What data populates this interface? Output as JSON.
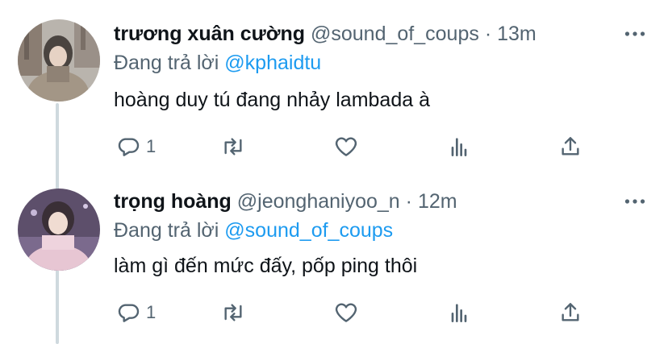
{
  "colors": {
    "text": "#0f1419",
    "muted": "#536471",
    "link": "#1d9bf0",
    "thread_line": "#cfd9de"
  },
  "tweets": [
    {
      "name": "trương xuân cường",
      "handle": "@sound_of_coups",
      "separator": "·",
      "time": "13m",
      "reply_label": "Đang trả lời",
      "reply_to": "@kphaidtu",
      "text": "hoàng duy tú đang nhảy lambada à",
      "reply_count": "1",
      "icons": [
        "more-icon",
        "reply-icon",
        "retweet-icon",
        "like-icon",
        "views-icon",
        "share-icon"
      ]
    },
    {
      "name": "trọng hoàng",
      "handle": "@jeonghaniyoo_n",
      "separator": "·",
      "time": "12m",
      "reply_label": "Đang trả lời",
      "reply_to": "@sound_of_coups",
      "text": "làm gì đến mức đấy, pốp ping thôi",
      "reply_count": "1",
      "icons": [
        "more-icon",
        "reply-icon",
        "retweet-icon",
        "like-icon",
        "views-icon",
        "share-icon"
      ]
    }
  ]
}
